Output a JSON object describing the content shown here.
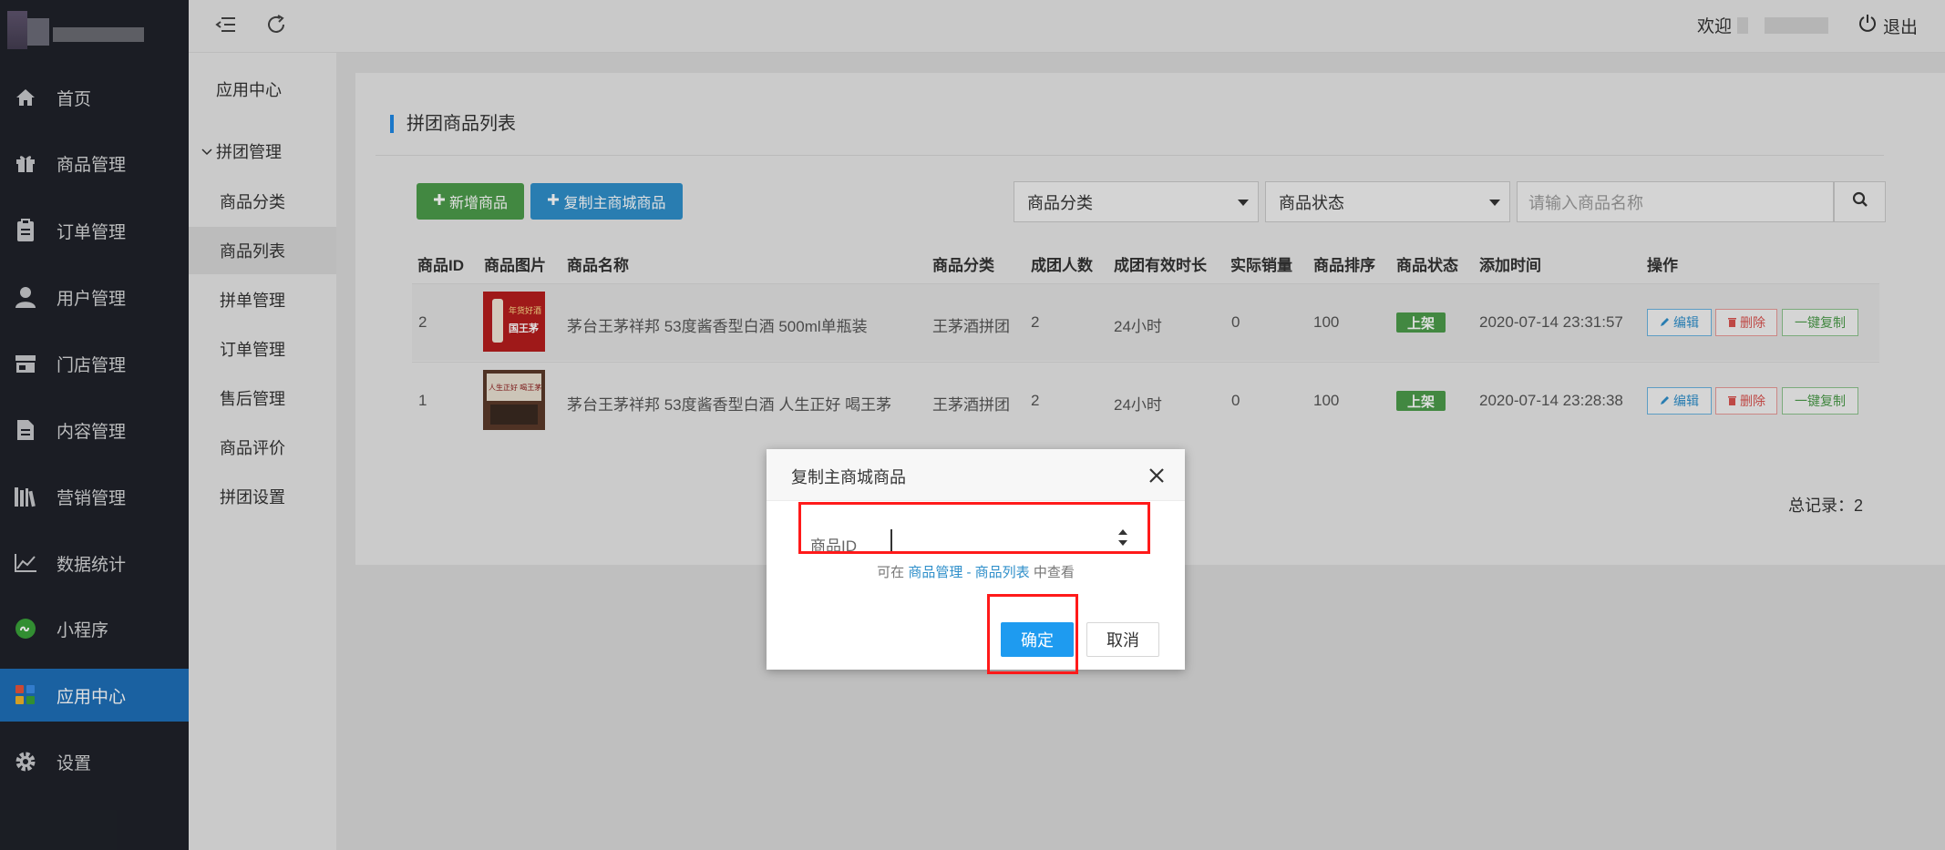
{
  "sidebar": {
    "items": [
      {
        "label": "首页",
        "icon": "home-icon"
      },
      {
        "label": "商品管理",
        "icon": "gift-icon"
      },
      {
        "label": "订单管理",
        "icon": "clipboard-icon"
      },
      {
        "label": "用户管理",
        "icon": "user-icon"
      },
      {
        "label": "门店管理",
        "icon": "store-icon"
      },
      {
        "label": "内容管理",
        "icon": "document-icon"
      },
      {
        "label": "营销管理",
        "icon": "books-icon"
      },
      {
        "label": "数据统计",
        "icon": "line-chart-icon"
      },
      {
        "label": "小程序",
        "icon": "mini-program-icon"
      },
      {
        "label": "应用中心",
        "icon": "apps-grid-icon",
        "active": true
      },
      {
        "label": "设置",
        "icon": "gear-icon"
      }
    ]
  },
  "topbar": {
    "welcome": "欢迎",
    "logout": "退出"
  },
  "subnav": {
    "title": "应用中心",
    "group": "拼团管理",
    "items": [
      {
        "label": "商品分类"
      },
      {
        "label": "商品列表",
        "active": true
      },
      {
        "label": "拼单管理"
      },
      {
        "label": "订单管理"
      },
      {
        "label": "售后管理"
      },
      {
        "label": "商品评价"
      },
      {
        "label": "拼团设置"
      }
    ]
  },
  "panel": {
    "title": "拼团商品列表",
    "add_button": "新增商品",
    "copy_button": "复制主商城商品",
    "category_select": "商品分类",
    "status_select": "商品状态",
    "search_placeholder": "请输入商品名称"
  },
  "table": {
    "headers": [
      "商品ID",
      "商品图片",
      "商品名称",
      "商品分类",
      "成团人数",
      "成团有效时长",
      "实际销量",
      "商品排序",
      "商品状态",
      "添加时间",
      "操作"
    ],
    "rows": [
      {
        "id": "2",
        "name": "茅台王茅祥邦 53度酱香型白酒 500ml单瓶装",
        "category": "王茅酒拼团",
        "group_size": "2",
        "duration": "24小时",
        "sales": "0",
        "sort": "100",
        "status": "上架",
        "time": "2020-07-14 23:31:57",
        "thumb_text_1": "年货好酒",
        "thumb_text_2": "国王茅"
      },
      {
        "id": "1",
        "name": "茅台王茅祥邦 53度酱香型白酒 人生正好 喝王茅",
        "category": "王茅酒拼团",
        "group_size": "2",
        "duration": "24小时",
        "sales": "0",
        "sort": "100",
        "status": "上架",
        "time": "2020-07-14 23:28:38",
        "thumb_text_1": "人生正好 喝王茅",
        "thumb_text_2": ""
      }
    ],
    "actions": {
      "edit": "编辑",
      "delete": "删除",
      "copy": "一键复制"
    },
    "total_label": "总记录：2"
  },
  "modal": {
    "title": "复制主商城商品",
    "field_label": "商品ID",
    "field_value": "",
    "hint_prefix": "可在",
    "hint_link": "商品管理 - 商品列表",
    "hint_suffix": "中查看",
    "ok": "确定",
    "cancel": "取消"
  },
  "colors": {
    "sidebar_bg": "#1f2229",
    "active_blue": "#1e6fb8",
    "green": "#4c9b4a",
    "blue": "#2f8fca",
    "highlight_red": "#ff1a1a"
  }
}
